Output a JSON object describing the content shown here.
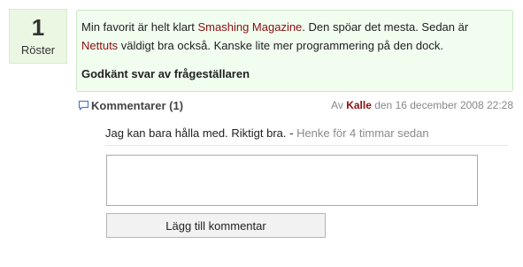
{
  "vote": {
    "count": "1",
    "label": "Röster"
  },
  "answer": {
    "text_1": "Min favorit är helt klart ",
    "link_1": "Smashing Magazine",
    "text_2": ". Den spöar det mesta. Sedan är ",
    "link_2": "Nettuts",
    "text_3": " väldigt bra också. Kanske lite mer programmering på den dock.",
    "accepted": "Godkänt svar av frågeställaren"
  },
  "comments": {
    "title": "Kommentarer (1)",
    "meta_prefix": "Av ",
    "meta_author": "Kalle",
    "meta_date": " den 16 december 2008 22:28",
    "icon": "comment-bubble-icon",
    "items": [
      {
        "text": "Jag kan bara hålla med. Riktigt bra.",
        "separator": " - ",
        "author": "Henke",
        "time": " för 4 timmar sedan"
      }
    ]
  },
  "form": {
    "input_value": "",
    "button_label": "Lägg till kommentar"
  },
  "colors": {
    "link": "#8b0f0f",
    "answer_bg": "#f0fdef",
    "vote_bg": "#ebf7e3"
  }
}
